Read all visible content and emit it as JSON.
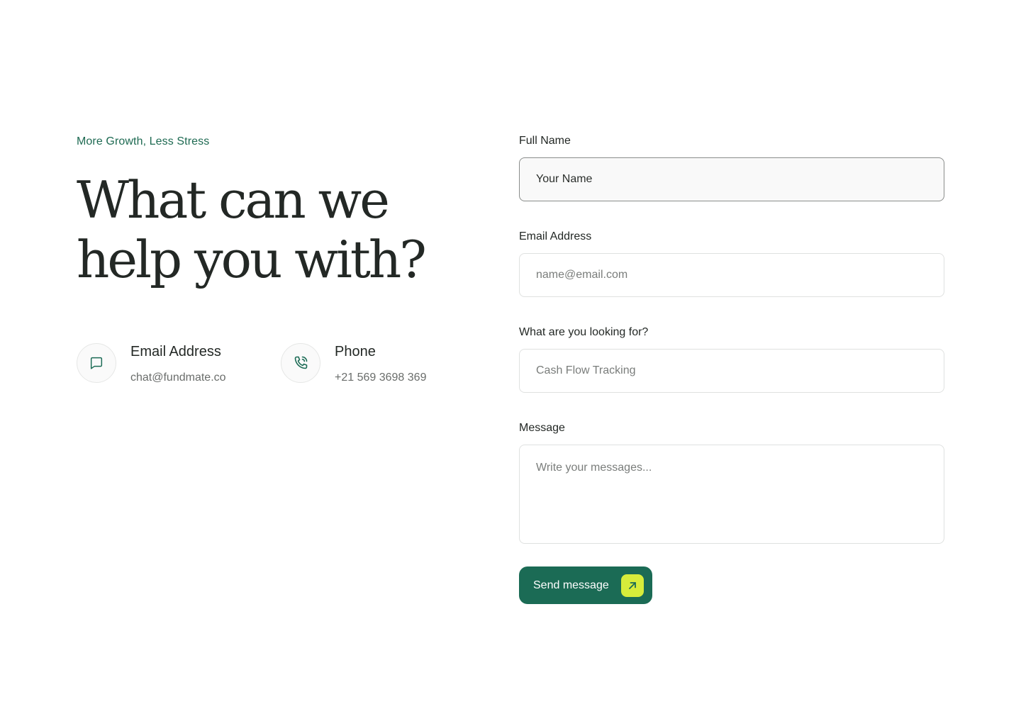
{
  "hero": {
    "eyebrow": "More Growth, Less Stress",
    "headline_line1": "What can we",
    "headline_line2": "help you with?"
  },
  "contacts": {
    "email": {
      "title": "Email Address",
      "value": "chat@fundmate.co",
      "icon": "chat-bubble-icon"
    },
    "phone": {
      "title": "Phone",
      "value": "+21 569 3698 369",
      "icon": "phone-call-icon"
    }
  },
  "form": {
    "full_name": {
      "label": "Full Name",
      "value": "Your Name"
    },
    "email": {
      "label": "Email Address",
      "placeholder": "name@email.com"
    },
    "looking_for": {
      "label": "What are you looking for?",
      "placeholder": "Cash Flow Tracking"
    },
    "message": {
      "label": "Message",
      "placeholder": "Write your messages..."
    },
    "submit": {
      "label": "Send message",
      "icon": "arrow-up-right-icon"
    }
  },
  "colors": {
    "brand_green": "#1b6b55",
    "accent_lime": "#d7ec3b",
    "text_dark": "#232825",
    "text_muted": "#6a6d6b"
  }
}
